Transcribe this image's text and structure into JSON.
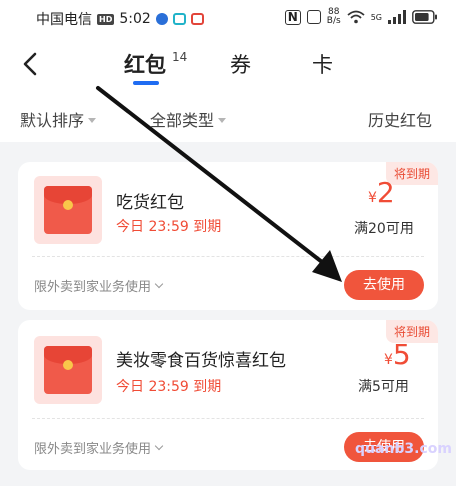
{
  "status_bar": {
    "carrier": "中国电信",
    "hd": "HD",
    "time": "5:02",
    "nfc": "N",
    "net_speed_value": "88",
    "net_speed_unit": "B/s",
    "signal_gen": "5G",
    "battery_level": 0.8
  },
  "header": {
    "tabs": [
      {
        "label": "红包",
        "count": "14",
        "active": true
      },
      {
        "label": "券",
        "active": false
      },
      {
        "label": "卡",
        "active": false
      }
    ],
    "accent_color": "#1f6cf2"
  },
  "filters": {
    "sort_label": "默认排序",
    "type_label": "全部类型",
    "history_label": "历史红包"
  },
  "coupons": [
    {
      "tag": "将到期",
      "name": "吃货红包",
      "expire": "今日 23:59 到期",
      "currency": "¥",
      "amount": "2",
      "threshold": "满20可用",
      "scope": "限外卖到家业务使用",
      "action": "去使用"
    },
    {
      "tag": "将到期",
      "name": "美妆零食百货惊喜红包",
      "expire": "今日 23:59 到期",
      "currency": "¥",
      "amount": "5",
      "threshold": "满5可用",
      "scope": "限外卖到家业务使用",
      "action": "去使用"
    }
  ],
  "watermark": "quanb3.com",
  "colors": {
    "primary_red": "#f04c36",
    "tag_bg": "#fde7e4"
  }
}
